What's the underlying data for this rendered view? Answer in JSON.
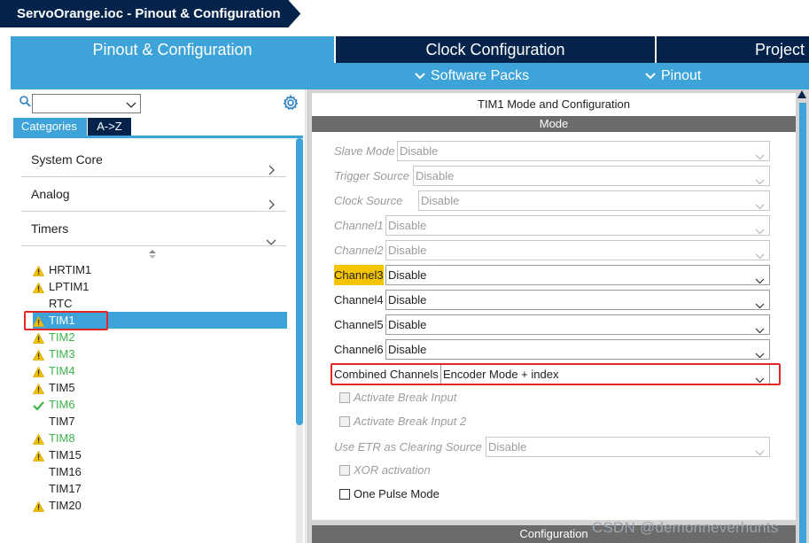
{
  "title_bar": {
    "title": "ServoOrange.ioc - Pinout & Configuration"
  },
  "main_tabs": [
    {
      "label": "Pinout & Configuration",
      "active": true
    },
    {
      "label": "Clock Configuration"
    },
    {
      "label": "Project"
    }
  ],
  "sub_menu": {
    "software_packs": "Software Packs",
    "pinout": "Pinout"
  },
  "left": {
    "search_value": "",
    "category_tabs": [
      "Categories",
      "A->Z"
    ],
    "categories": [
      {
        "label": "System Core",
        "icon": "chevron-right-icon"
      },
      {
        "label": "Analog",
        "icon": "chevron-right-icon"
      },
      {
        "label": "Timers",
        "icon": "chevron-down-icon"
      }
    ],
    "timers": [
      {
        "label": "HRTIM1",
        "status": "warning"
      },
      {
        "label": "LPTIM1",
        "status": "warning"
      },
      {
        "label": "RTC",
        "status": "none"
      },
      {
        "label": "TIM1",
        "status": "warning",
        "selected": true
      },
      {
        "label": "TIM2",
        "status": "warning",
        "green": true
      },
      {
        "label": "TIM3",
        "status": "warning",
        "green": true
      },
      {
        "label": "TIM4",
        "status": "warning",
        "green": true
      },
      {
        "label": "TIM5",
        "status": "warning"
      },
      {
        "label": "TIM6",
        "status": "check",
        "green": true
      },
      {
        "label": "TIM7",
        "status": "none"
      },
      {
        "label": "TIM8",
        "status": "warning",
        "green": true
      },
      {
        "label": "TIM15",
        "status": "warning"
      },
      {
        "label": "TIM16",
        "status": "none"
      },
      {
        "label": "TIM17",
        "status": "none"
      },
      {
        "label": "TIM20",
        "status": "warning"
      }
    ]
  },
  "right": {
    "header": "TIM1 Mode and Configuration",
    "mode_bar": "Mode",
    "config_bar": "Configuration",
    "fields": [
      {
        "label": "Slave Mode",
        "value": "Disable",
        "enabled": false
      },
      {
        "label": "Trigger Source",
        "value": "Disable",
        "enabled": false
      },
      {
        "label": "Clock Source",
        "value": "Disable",
        "enabled": false
      },
      {
        "label": "Channel1",
        "value": "Disable",
        "enabled": false
      },
      {
        "label": "Channel2",
        "value": "Disable",
        "enabled": false
      },
      {
        "label": "Channel3",
        "value": "Disable",
        "enabled": true,
        "highlight": true
      },
      {
        "label": "Channel4",
        "value": "Disable",
        "enabled": true
      },
      {
        "label": "Channel5",
        "value": "Disable",
        "enabled": true
      },
      {
        "label": "Channel6",
        "value": "Disable",
        "enabled": true
      },
      {
        "label": "Combined Channels",
        "value": "Encoder Mode + index",
        "enabled": true
      }
    ],
    "checks": [
      {
        "label": "Activate Break Input",
        "enabled": false
      },
      {
        "label": "Activate Break Input 2",
        "enabled": false
      }
    ],
    "etr": {
      "label": "Use ETR as Clearing Source",
      "value": "Disable",
      "enabled": false
    },
    "checks2": [
      {
        "label": "XOR activation",
        "enabled": false
      },
      {
        "label": "One Pulse Mode",
        "enabled": true
      }
    ]
  },
  "watermark": "CSDN @demonneverhunts",
  "colors": {
    "navy": "#03234b",
    "blue": "#3ea3d9",
    "highlight_red": "#e32626",
    "yellow": "#f5c400",
    "green": "#3cb44b"
  }
}
